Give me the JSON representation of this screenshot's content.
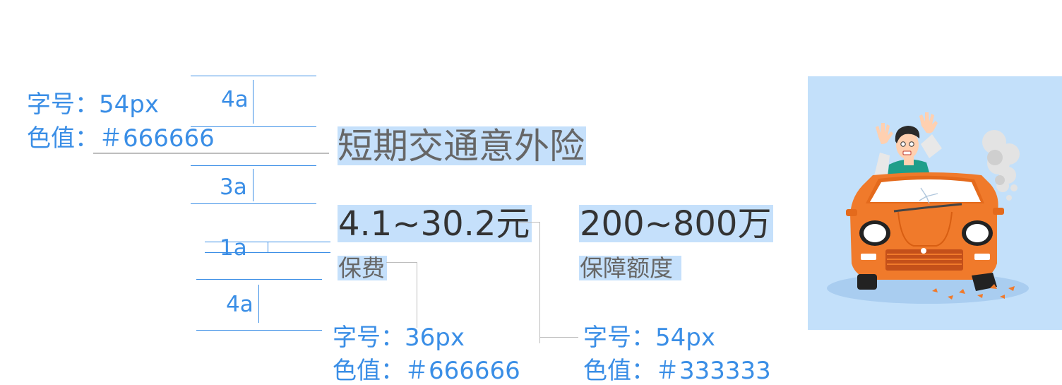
{
  "spec": {
    "title_spec": {
      "font_size": "字号：54px",
      "color_value": "色值：＃666666"
    },
    "label_spec": {
      "font_size": "字号：36px",
      "color_value": "色值：＃666666"
    },
    "value_spec": {
      "font_size": "字号：54px",
      "color_value": "色值：＃333333"
    }
  },
  "spacing": [
    "4a",
    "3a",
    "1a",
    "4a"
  ],
  "card": {
    "title": "短期交通意外险",
    "premium_value": "4.1~30.2元",
    "premium_label": "保费",
    "coverage_value": "200~800万",
    "coverage_label": "保障额度"
  },
  "colors": {
    "annotation": "#3a8ee6",
    "highlight": "#c5e0fb",
    "text_primary": "#333333",
    "text_secondary": "#666666",
    "illustration_bg": "#c3e0fa",
    "car": "#f07a2b"
  },
  "illustration": {
    "subject": "car-accident-icon"
  }
}
